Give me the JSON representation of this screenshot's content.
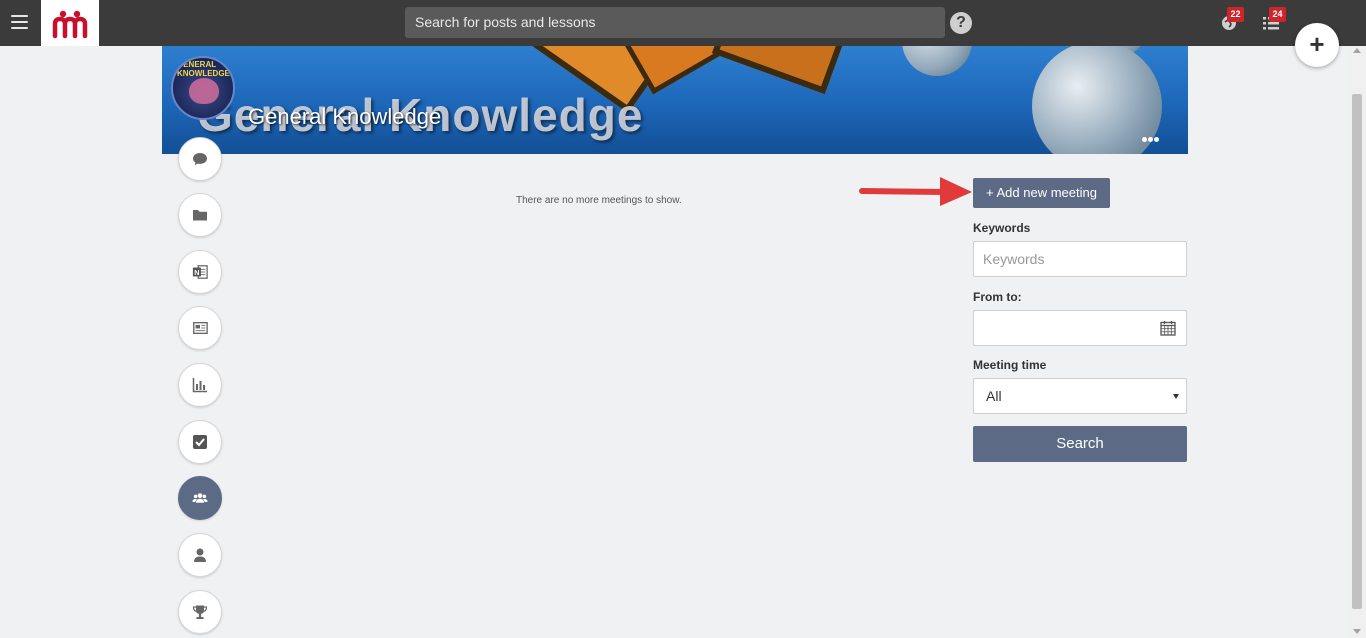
{
  "topbar": {
    "search_placeholder": "Search for posts and lessons",
    "help": "?",
    "notifications_count": "22",
    "tasks_count": "24"
  },
  "fab_label": "+",
  "banner": {
    "title": "General Knowledge",
    "ghost_text": "General Knowledge"
  },
  "avatar_text": "GENERAL KNOWLEDGE",
  "side_nav": [
    {
      "name": "chat-icon",
      "active": false
    },
    {
      "name": "folder-icon",
      "active": false
    },
    {
      "name": "onenote-icon",
      "active": false
    },
    {
      "name": "newspaper-icon",
      "active": false
    },
    {
      "name": "bar-chart-icon",
      "active": false
    },
    {
      "name": "checkbox-icon",
      "active": false
    },
    {
      "name": "users-icon",
      "active": true
    },
    {
      "name": "user-icon",
      "active": false
    },
    {
      "name": "trophy-icon",
      "active": false
    }
  ],
  "main": {
    "empty_message": "There are no more meetings to show."
  },
  "filters": {
    "add_button": "+ Add new meeting",
    "keywords_label": "Keywords",
    "keywords_placeholder": "Keywords",
    "from_to_label": "From to:",
    "from_to_value": "",
    "meeting_time_label": "Meeting time",
    "meeting_time_value": "All",
    "search_button": "Search"
  },
  "colors": {
    "topbar": "#3b3b3b",
    "accent": "#5c6a86",
    "badge": "#d0242b",
    "annotation_arrow": "#e03a3a"
  }
}
